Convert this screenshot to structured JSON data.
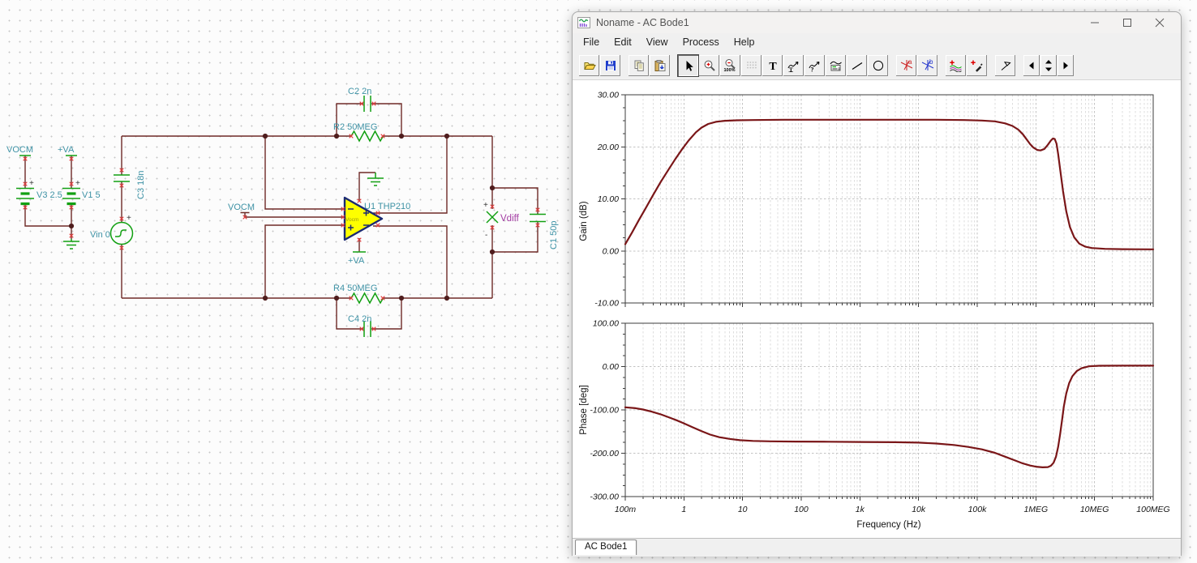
{
  "window": {
    "title": "Noname - AC Bode1",
    "menu": [
      "File",
      "Edit",
      "View",
      "Process",
      "Help"
    ],
    "tab": "AC Bode1",
    "icon_glyphs": {
      "text_tool": "T",
      "zoom_100": "100%",
      "cursor_a": "a",
      "cursor_b": "b"
    },
    "toolbar_items": [
      "open",
      "save",
      "copy",
      "paste",
      "select-tool",
      "zoom-in",
      "zoom-100",
      "grid-toggle",
      "text-tool",
      "curve-label-tool",
      "curve-query-tool",
      "legend-tool",
      "line-tool",
      "ellipse-tool",
      "cursor-a-tool",
      "cursor-b-tool",
      "add-curve-tool",
      "trace-pick-tool",
      "marker-tool",
      "page-prev",
      "page-spinner",
      "page-next"
    ]
  },
  "schematic": {
    "labels": {
      "vocm_src": "VOCM",
      "va_src": "+VA",
      "v3": "V3 2.5",
      "v1": "V1 5",
      "vin": "Vin 0",
      "c3": "C3 18n",
      "c2": "C2 2n",
      "r2": "R2 50MEG",
      "vocm_in": "VOCM",
      "u1": "U1 THP210",
      "vocm_pin": "Vocm",
      "va_pin": "+VA",
      "r4": "R4 50MEG",
      "c4": "C4 2n",
      "vdiff": "Vdiff",
      "c1": "C1 50p",
      "plus": "+",
      "minus": "-"
    },
    "colors": {
      "wire": "#6e2a26",
      "component": "#12a012",
      "label": "#3e92a5",
      "opamp_fill": "#feff00",
      "opamp_border": "#1b2a72",
      "meter_label": "#a23aa2",
      "pin_mark": "#e13b3b"
    }
  },
  "chart_data": [
    {
      "type": "line",
      "name": "gain",
      "ylabel": "Gain (dB)",
      "xlabel": "Frequency (Hz)",
      "ylim": [
        -10,
        30
      ],
      "xlim": [
        0.1,
        100000000
      ],
      "log_x": true,
      "grid": true,
      "show_x_labels": false,
      "y_ticks": [
        {
          "v": 30,
          "label": "30.00"
        },
        {
          "v": 20,
          "label": "20.00"
        },
        {
          "v": 10,
          "label": "10.00"
        },
        {
          "v": 0,
          "label": "0.00"
        },
        {
          "v": -10,
          "label": "-10.00"
        }
      ],
      "x_ticks": [
        {
          "f": 0.1,
          "label": "100m"
        },
        {
          "f": 1,
          "label": "1"
        },
        {
          "f": 10,
          "label": "10"
        },
        {
          "f": 100,
          "label": "100"
        },
        {
          "f": 1000,
          "label": "1k"
        },
        {
          "f": 10000,
          "label": "10k"
        },
        {
          "f": 100000,
          "label": "100k"
        },
        {
          "f": 1000000,
          "label": "1MEG"
        },
        {
          "f": 10000000,
          "label": "10MEG"
        },
        {
          "f": 100000000,
          "label": "100MEG"
        }
      ],
      "series": [
        {
          "name": "gain",
          "color": "#7a1618",
          "points": [
            [
              0.1,
              1.3
            ],
            [
              0.13,
              3.5
            ],
            [
              0.17,
              5.9
            ],
            [
              0.22,
              8.1
            ],
            [
              0.3,
              10.8
            ],
            [
              0.4,
              13.2
            ],
            [
              0.55,
              15.7
            ],
            [
              0.7,
              17.5
            ],
            [
              0.9,
              19.3
            ],
            [
              1.2,
              21.2
            ],
            [
              1.6,
              22.8
            ],
            [
              2,
              23.7
            ],
            [
              2.6,
              24.4
            ],
            [
              3.5,
              24.8
            ],
            [
              5,
              25.0
            ],
            [
              8,
              25.1
            ],
            [
              15,
              25.15
            ],
            [
              50,
              25.2
            ],
            [
              200,
              25.2
            ],
            [
              1000,
              25.2
            ],
            [
              5000,
              25.2
            ],
            [
              20000,
              25.2
            ],
            [
              60000,
              25.15
            ],
            [
              120000,
              25.05
            ],
            [
              200000,
              24.9
            ],
            [
              300000,
              24.5
            ],
            [
              400000,
              24.0
            ],
            [
              500000,
              23.3
            ],
            [
              600000,
              22.4
            ],
            [
              700000,
              21.4
            ],
            [
              800000,
              20.5
            ],
            [
              900000,
              19.9
            ],
            [
              1050000.0,
              19.4
            ],
            [
              1200000.0,
              19.3
            ],
            [
              1400000.0,
              19.6
            ],
            [
              1600000.0,
              20.4
            ],
            [
              1800000.0,
              21.2
            ],
            [
              1950000.0,
              21.6
            ],
            [
              2100000.0,
              21.5
            ],
            [
              2250000.0,
              20.6
            ],
            [
              2400000.0,
              18.6
            ],
            [
              2600000.0,
              15.6
            ],
            [
              2900000.0,
              11.5
            ],
            [
              3300000.0,
              7.6
            ],
            [
              3800000.0,
              4.6
            ],
            [
              4500000.0,
              2.6
            ],
            [
              5500000.0,
              1.4
            ],
            [
              7000000.0,
              0.8
            ],
            [
              9000000.0,
              0.55
            ],
            [
              15000000.0,
              0.4
            ],
            [
              30000000.0,
              0.33
            ],
            [
              100000000.0,
              0.3
            ]
          ]
        }
      ]
    },
    {
      "type": "line",
      "name": "phase",
      "ylabel": "Phase [deg]",
      "xlabel": "Frequency (Hz)",
      "ylim": [
        -300,
        100
      ],
      "xlim": [
        0.1,
        100000000
      ],
      "log_x": true,
      "grid": true,
      "show_x_labels": true,
      "y_ticks": [
        {
          "v": 100,
          "label": "100.00"
        },
        {
          "v": 0,
          "label": "0.00"
        },
        {
          "v": -100,
          "label": "-100.00"
        },
        {
          "v": -200,
          "label": "-200.00"
        },
        {
          "v": -300,
          "label": "-300.00"
        }
      ],
      "x_ticks": [
        {
          "f": 0.1,
          "label": "100m"
        },
        {
          "f": 1,
          "label": "1"
        },
        {
          "f": 10,
          "label": "10"
        },
        {
          "f": 100,
          "label": "100"
        },
        {
          "f": 1000,
          "label": "1k"
        },
        {
          "f": 10000,
          "label": "10k"
        },
        {
          "f": 100000,
          "label": "100k"
        },
        {
          "f": 1000000,
          "label": "1MEG"
        },
        {
          "f": 10000000,
          "label": "10MEG"
        },
        {
          "f": 100000000,
          "label": "100MEG"
        }
      ],
      "series": [
        {
          "name": "phase",
          "color": "#7a1618",
          "points": [
            [
              0.1,
              -94
            ],
            [
              0.15,
              -96
            ],
            [
              0.2,
              -99
            ],
            [
              0.28,
              -104
            ],
            [
              0.4,
              -110
            ],
            [
              0.55,
              -117
            ],
            [
              0.75,
              -124
            ],
            [
              1,
              -131
            ],
            [
              1.4,
              -140
            ],
            [
              2,
              -149
            ],
            [
              2.8,
              -157
            ],
            [
              4,
              -163
            ],
            [
              6,
              -167
            ],
            [
              9,
              -170
            ],
            [
              15,
              -171.5
            ],
            [
              30,
              -172.5
            ],
            [
              80,
              -173
            ],
            [
              300,
              -173.5
            ],
            [
              1000,
              -174
            ],
            [
              4000,
              -174.5
            ],
            [
              10000,
              -175.5
            ],
            [
              20000,
              -177.5
            ],
            [
              40000,
              -181
            ],
            [
              70000,
              -185.5
            ],
            [
              120000,
              -191
            ],
            [
              200000,
              -199
            ],
            [
              300000,
              -208
            ],
            [
              450000,
              -217
            ],
            [
              600000,
              -223.5
            ],
            [
              800000,
              -228.5
            ],
            [
              1000000.0,
              -231
            ],
            [
              1300000.0,
              -232.5
            ],
            [
              1600000.0,
              -232
            ],
            [
              1800000.0,
              -229
            ],
            [
              2000000.0,
              -222
            ],
            [
              2200000.0,
              -208
            ],
            [
              2400000.0,
              -185
            ],
            [
              2600000.0,
              -155
            ],
            [
              2800000.0,
              -122
            ],
            [
              3000000.0,
              -92
            ],
            [
              3300000.0,
              -62
            ],
            [
              3700000.0,
              -38
            ],
            [
              4200000.0,
              -22
            ],
            [
              5000000.0,
              -10
            ],
            [
              6000000.0,
              -4
            ],
            [
              8000000.0,
              0.5
            ],
            [
              12000000.0,
              1.8
            ],
            [
              30000000.0,
              2
            ],
            [
              100000000.0,
              2
            ]
          ]
        }
      ]
    }
  ]
}
